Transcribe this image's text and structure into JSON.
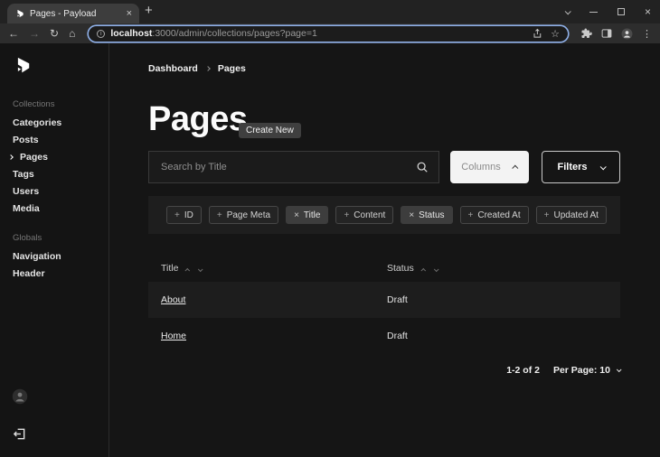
{
  "browser": {
    "tab_title": "Pages - Payload",
    "url_host": "localhost",
    "url_rest": ":3000/admin/collections/pages?page=1"
  },
  "sidebar": {
    "collections_label": "Collections",
    "collections": [
      {
        "label": "Categories",
        "active": false
      },
      {
        "label": "Posts",
        "active": false
      },
      {
        "label": "Pages",
        "active": true
      },
      {
        "label": "Tags",
        "active": false
      },
      {
        "label": "Users",
        "active": false
      },
      {
        "label": "Media",
        "active": false
      }
    ],
    "globals_label": "Globals",
    "globals": [
      {
        "label": "Navigation"
      },
      {
        "label": "Header"
      }
    ]
  },
  "main": {
    "breadcrumb": {
      "dashboard": "Dashboard",
      "current": "Pages"
    },
    "title": "Pages",
    "create_button_label": "Create New",
    "search_placeholder": "Search by Title",
    "columns_button_label": "Columns",
    "filters_button_label": "Filters",
    "column_pills": [
      {
        "icon": "+",
        "label": "ID",
        "active": false
      },
      {
        "icon": "+",
        "label": "Page Meta",
        "active": false
      },
      {
        "icon": "×",
        "label": "Title",
        "active": true
      },
      {
        "icon": "+",
        "label": "Content",
        "active": false
      },
      {
        "icon": "×",
        "label": "Status",
        "active": true
      },
      {
        "icon": "+",
        "label": "Created At",
        "active": false
      },
      {
        "icon": "+",
        "label": "Updated At",
        "active": false
      }
    ],
    "table": {
      "columns": [
        {
          "label": "Title"
        },
        {
          "label": "Status"
        }
      ],
      "rows": [
        {
          "title": "About",
          "status": "Draft"
        },
        {
          "title": "Home",
          "status": "Draft"
        }
      ]
    },
    "pagination": {
      "range": "1-2 of 2",
      "per_page": "Per Page: 10"
    }
  },
  "colors": {
    "app_background": "#151515",
    "panel_background": "#1e1e1e",
    "row_stripe": "#1d1d1d",
    "sidebar_divider": "#2b2b2b",
    "url_focus_ring": "#8fb0e8",
    "columns_button_background": "#f3f3f3",
    "active_pill_background": "#3d3d3d",
    "text_primary": "#f0f0f0",
    "text_muted": "#8a8a8a"
  }
}
